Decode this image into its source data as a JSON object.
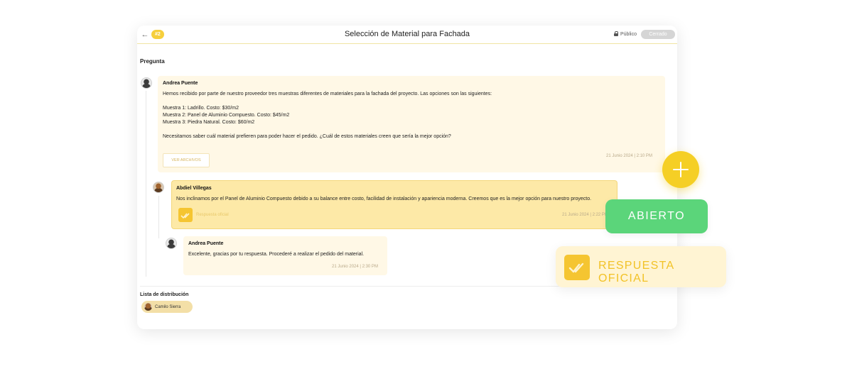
{
  "header": {
    "back_icon": "arrow-left-icon",
    "number_badge": "#2",
    "title": "Selección de Material para Fachada",
    "visibility_label": "Público",
    "status_label": "Cerrado"
  },
  "question_label": "Pregunta",
  "messages": [
    {
      "author": "Andrea Puente",
      "body": "Hemos recibido por parte de nuestro proveedor tres muestras diferentes de materiales para la fachada del proyecto. Las opciones son las siguientes:\n\nMuestra 1: Ladrillo. Costo: $30/m2\nMuestra 2: Panel de Aluminio Compuesto. Costo: $45/m2\nMuestra 3: Piedra Natural. Costo: $60/m2\n\nNecesitamos saber cuál material prefieren para poder hacer el pedido. ¿Cuál de estos materiales creen que sería la mejor opción?",
      "files_button": "VER ARCHIVOS",
      "timestamp": "21 Junio 2024 | 2:10 PM"
    },
    {
      "author": "Abdiel Villegas",
      "body": "Nos inclinamos por el Panel de Aluminio Compuesto debido a su balance entre costo, facilidad de instalación y apariencia moderna. Creemos que es la mejor opción para nuestro proyecto.",
      "official_label": "Respuesta oficial",
      "timestamp": "21 Junio 2024 | 2:22 PM"
    },
    {
      "author": "Andrea Puente",
      "body": "Excelente, gracias por tu respuesta. Procederé a realizar el pedido del material.",
      "timestamp": "21 Junio 2024 | 2:30 PM"
    }
  ],
  "distribution": {
    "label": "Lista de distribución",
    "members": [
      "Camilo Sierra"
    ]
  },
  "floating": {
    "add_icon": "plus-icon",
    "status_open": "ABIERTO",
    "official_answer": "RESPUESTA OFICIAL",
    "official_icon": "double-check-icon"
  },
  "colors": {
    "accent_yellow": "#f5cf25",
    "open_green": "#5bd57a",
    "closed_gray": "#d5d5d5",
    "official_bg": "#fde9a7"
  }
}
